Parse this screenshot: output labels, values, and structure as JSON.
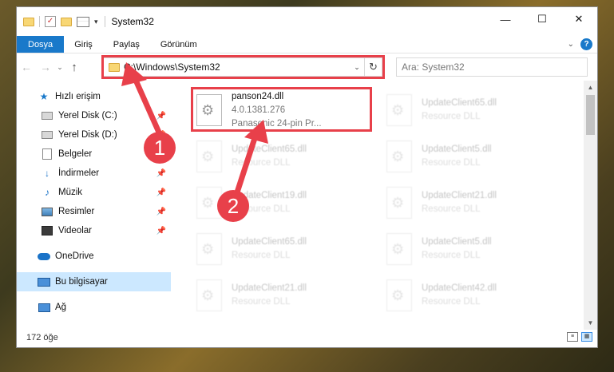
{
  "window": {
    "title": "System32",
    "min_glyph": "—",
    "max_glyph": "☐",
    "close_glyph": "✕"
  },
  "ribbon": {
    "tabs": [
      "Dosya",
      "Giriş",
      "Paylaş",
      "Görünüm"
    ]
  },
  "nav": {
    "back_glyph": "←",
    "forward_glyph": "→",
    "recent_glyph": "⌄",
    "up_glyph": "↑",
    "address": "C:\\Windows\\System32",
    "search_placeholder": "Ara: System32"
  },
  "sidebar": {
    "items": [
      {
        "label": "Hızlı erişim",
        "icon": "star-icon"
      },
      {
        "label": "Yerel Disk (C:)",
        "icon": "drive-icon",
        "pinned": true
      },
      {
        "label": "Yerel Disk (D:)",
        "icon": "drive-icon",
        "pinned": true
      },
      {
        "label": "Belgeler",
        "icon": "document-icon",
        "pinned": true
      },
      {
        "label": "İndirmeler",
        "icon": "download-icon",
        "pinned": true
      },
      {
        "label": "Müzik",
        "icon": "music-icon",
        "pinned": true
      },
      {
        "label": "Resimler",
        "icon": "pictures-icon",
        "pinned": true
      },
      {
        "label": "Videolar",
        "icon": "video-icon",
        "pinned": true
      },
      {
        "label": "OneDrive",
        "icon": "cloud-icon"
      },
      {
        "label": "Bu bilgisayar",
        "icon": "computer-icon",
        "selected": true
      },
      {
        "label": "Ağ",
        "icon": "network-icon"
      }
    ]
  },
  "files": {
    "highlighted": {
      "name": "panson24.dll",
      "version": "4.0.1381.276",
      "description": "Panasonic 24-pin Pr..."
    },
    "faded": [
      {
        "name": "UpdateClient65.dll",
        "type": "Resource DLL"
      },
      {
        "name": "UpdateClient65.dll",
        "type": "Resource DLL"
      },
      {
        "name": "UpdateClient5.dll",
        "type": "Resource DLL"
      },
      {
        "name": "UpdateClient19.dll",
        "type": "Resource DLL"
      },
      {
        "name": "UpdateClient21.dll",
        "type": "Resource DLL"
      },
      {
        "name": "UpdateClient65.dll",
        "type": "Resource DLL"
      },
      {
        "name": "UpdateClient5.dll",
        "type": "Resource DLL"
      },
      {
        "name": "UpdateClient21.dll",
        "type": "Resource DLL"
      },
      {
        "name": "UpdateClient42.dll",
        "type": "Resource DLL"
      }
    ]
  },
  "status": {
    "count": "172 öğe"
  },
  "annotations": {
    "callout_1": "1",
    "callout_2": "2",
    "color": "#e8404a"
  },
  "colors": {
    "accent": "#1979ca",
    "selected_bg": "#cce8ff"
  }
}
